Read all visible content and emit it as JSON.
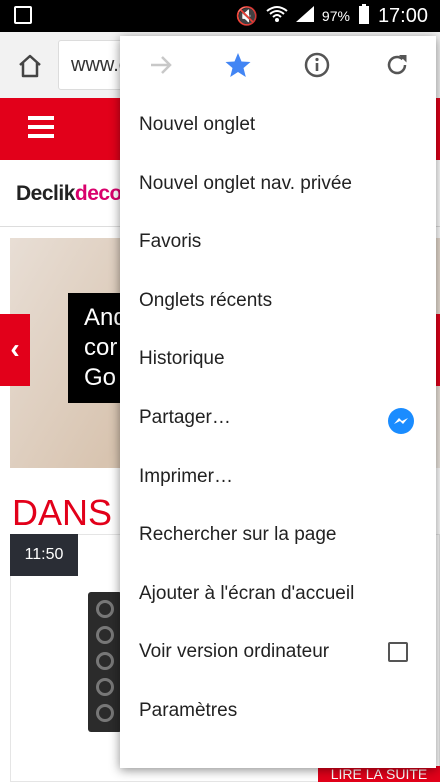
{
  "status_bar": {
    "battery": "97%",
    "time": "17:00"
  },
  "browser": {
    "url": "www.commentcamarche.net"
  },
  "site": {
    "logo_part1": "Declik",
    "logo_part2": "deco",
    "hero_text": "And\ncor\nGo",
    "section_title": "DANS L",
    "time_badge": "11:50",
    "read_more": "LIRE LA SUITE"
  },
  "menu": {
    "icons": [
      "forward-icon",
      "star-icon",
      "info-icon",
      "refresh-icon"
    ],
    "items": [
      {
        "label": "Nouvel onglet"
      },
      {
        "label": "Nouvel onglet nav. privée"
      },
      {
        "label": "Favoris"
      },
      {
        "label": "Onglets récents"
      },
      {
        "label": "Historique"
      },
      {
        "label": "Partager…"
      },
      {
        "label": "Imprimer…"
      },
      {
        "label": "Rechercher sur la page"
      },
      {
        "label": "Ajouter à l'écran d'accueil"
      },
      {
        "label": "Voir version ordinateur"
      },
      {
        "label": "Paramètres"
      }
    ]
  },
  "colors": {
    "brand_red": "#e2001a",
    "star_blue": "#4285f4",
    "messenger_blue": "#1a8cff"
  }
}
